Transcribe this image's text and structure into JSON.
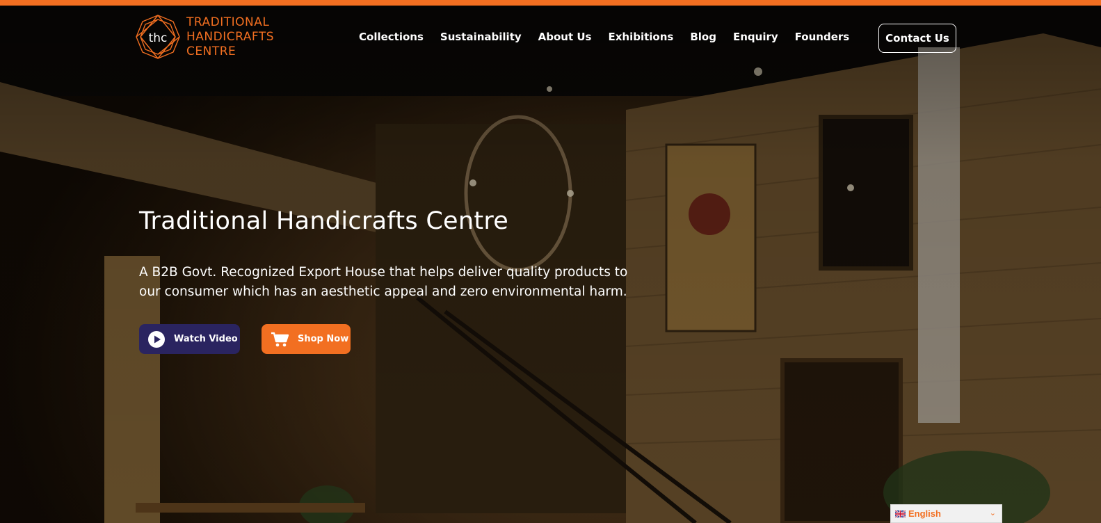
{
  "brand": {
    "line1": "TRADITIONAL",
    "line2": "HANDICRAFTS",
    "line3": "CENTRE",
    "mark_letters": "thc",
    "accent_color": "#f26f21"
  },
  "nav": {
    "items": [
      "Collections",
      "Sustainability",
      "About Us",
      "Exhibitions",
      "Blog",
      "Enquiry",
      "Founders"
    ],
    "contact_label": "Contact Us"
  },
  "hero": {
    "title": "Traditional Handicrafts Centre",
    "subtitle": "A B2B Govt. Recognized Export House that helps deliver quality products to our consumer which has an aesthetic appeal and zero environmental harm.",
    "watch_video_label": "Watch Video",
    "watch_video_icon": "play-icon",
    "shop_now_label": "Shop Now",
    "shop_now_icon": "cart-icon",
    "video_button_color": "#2a2460",
    "shop_button_color": "#f26f21"
  },
  "language": {
    "selected": "English",
    "flag_icon": "uk-flag-icon"
  }
}
